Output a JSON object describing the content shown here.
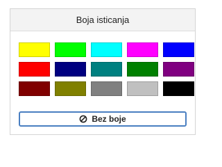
{
  "panel": {
    "title": "Boja isticanja"
  },
  "swatches": [
    {
      "color": "#ffff00",
      "name": "yellow"
    },
    {
      "color": "#00ff00",
      "name": "bright-green"
    },
    {
      "color": "#00ffff",
      "name": "turquoise"
    },
    {
      "color": "#ff00ff",
      "name": "pink"
    },
    {
      "color": "#0000ff",
      "name": "blue"
    },
    {
      "color": "#ff0000",
      "name": "red"
    },
    {
      "color": "#000080",
      "name": "dark-blue"
    },
    {
      "color": "#008080",
      "name": "teal"
    },
    {
      "color": "#008000",
      "name": "green"
    },
    {
      "color": "#800080",
      "name": "violet"
    },
    {
      "color": "#800000",
      "name": "dark-red"
    },
    {
      "color": "#808000",
      "name": "dark-yellow"
    },
    {
      "color": "#808080",
      "name": "gray-50"
    },
    {
      "color": "#c0c0c0",
      "name": "gray-25"
    },
    {
      "color": "#000000",
      "name": "black"
    }
  ],
  "no_color_button": {
    "label": "Bez boje",
    "icon": "no-color-icon",
    "border_color": "#4a7fc1"
  }
}
